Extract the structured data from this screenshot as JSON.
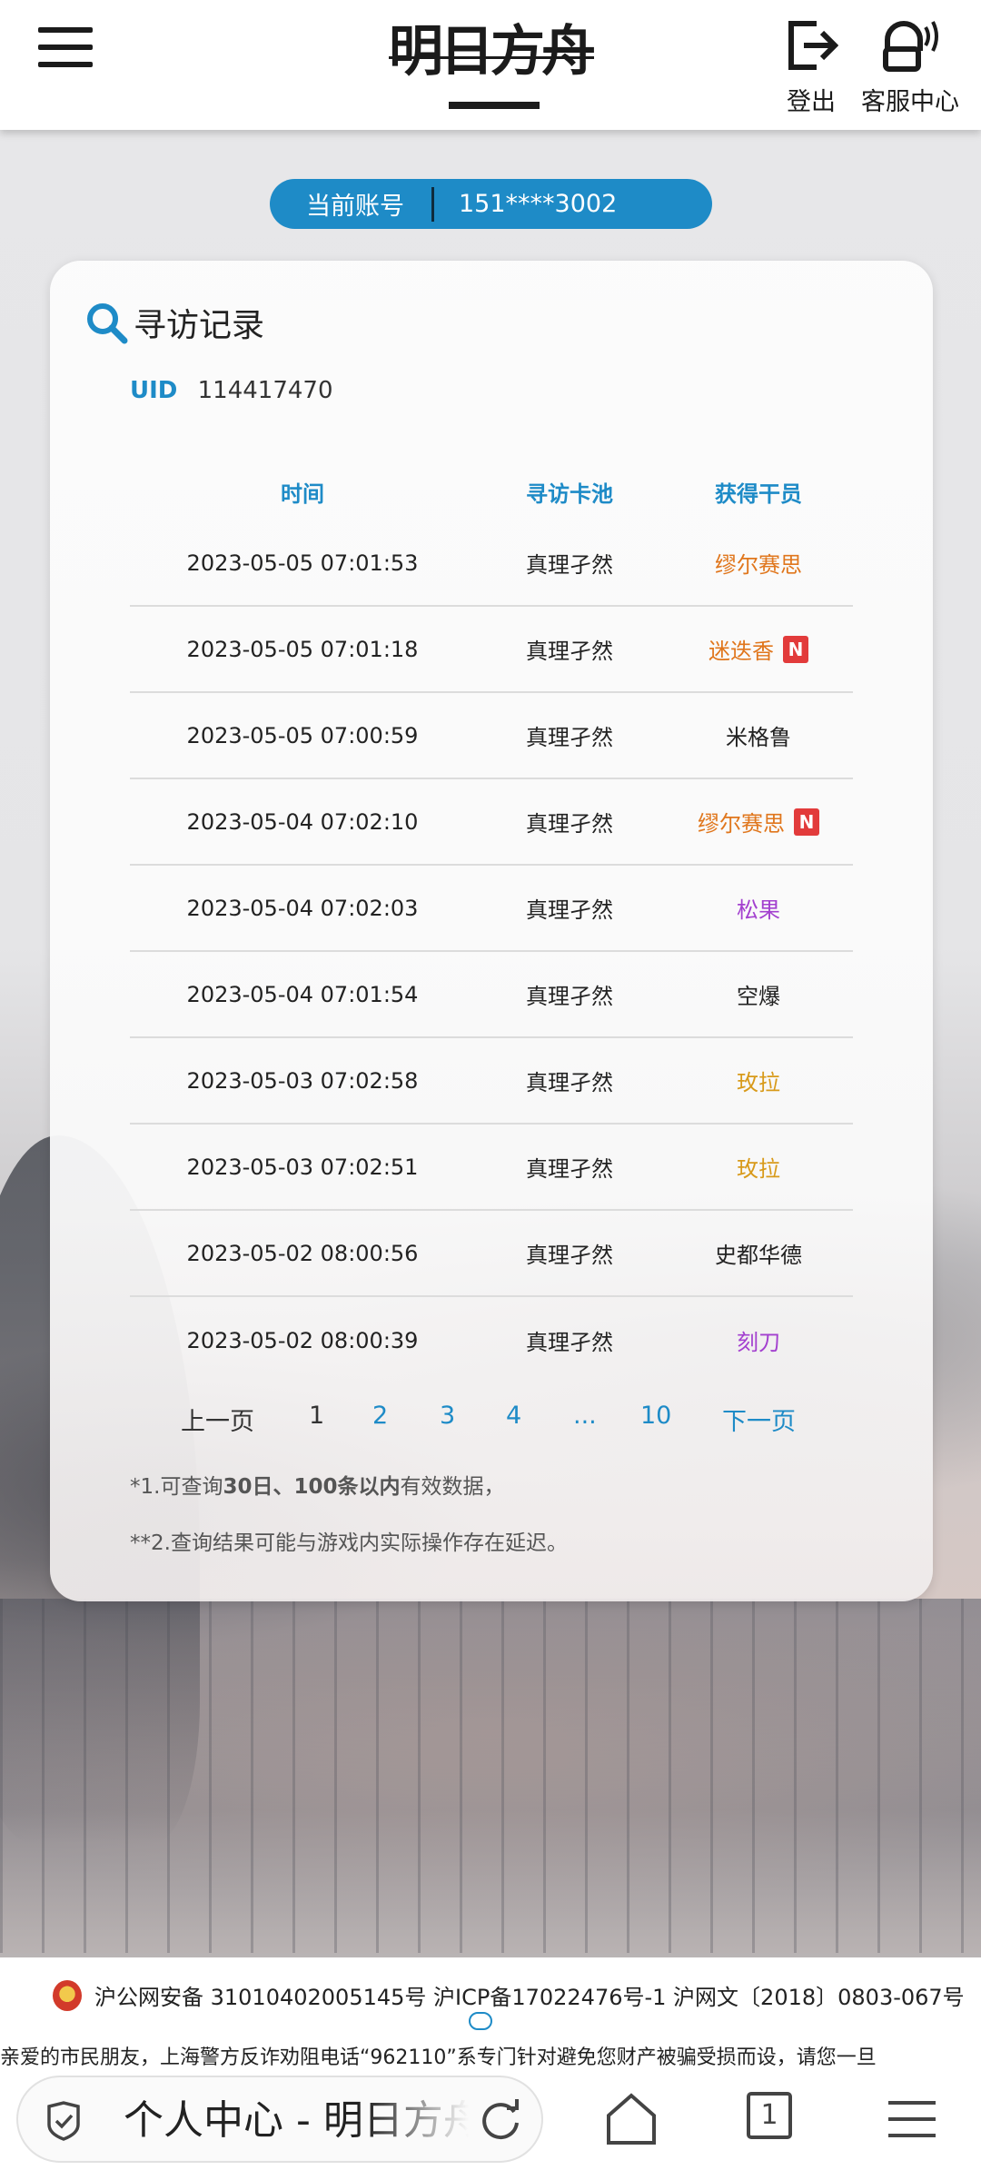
{
  "header": {
    "logo_text": "明日方舟",
    "logout_label": "登出",
    "service_label": "客服中心"
  },
  "account": {
    "label": "当前账号",
    "value": "151****3002"
  },
  "card": {
    "title": "寻访记录",
    "uid_label": "UID",
    "uid_value": "114417470",
    "columns": {
      "time": "时间",
      "pool": "寻访卡池",
      "operator": "获得干员"
    },
    "rows": [
      {
        "time": "2023-05-05 07:01:53",
        "pool": "真理孑然",
        "operator": "缪尔赛思",
        "rarity": "orange",
        "new": ""
      },
      {
        "time": "2023-05-05 07:01:18",
        "pool": "真理孑然",
        "operator": "迷迭香",
        "rarity": "orange",
        "new": "N"
      },
      {
        "time": "2023-05-05 07:00:59",
        "pool": "真理孑然",
        "operator": "米格鲁",
        "rarity": "normal",
        "new": ""
      },
      {
        "time": "2023-05-04 07:02:10",
        "pool": "真理孑然",
        "operator": "缪尔赛思",
        "rarity": "orange",
        "new": "N"
      },
      {
        "time": "2023-05-04 07:02:03",
        "pool": "真理孑然",
        "operator": "松果",
        "rarity": "purple",
        "new": ""
      },
      {
        "time": "2023-05-04 07:01:54",
        "pool": "真理孑然",
        "operator": "空爆",
        "rarity": "normal",
        "new": ""
      },
      {
        "time": "2023-05-03 07:02:58",
        "pool": "真理孑然",
        "operator": "玫拉",
        "rarity": "gold",
        "new": ""
      },
      {
        "time": "2023-05-03 07:02:51",
        "pool": "真理孑然",
        "operator": "玫拉",
        "rarity": "gold",
        "new": ""
      },
      {
        "time": "2023-05-02 08:00:56",
        "pool": "真理孑然",
        "operator": "史都华德",
        "rarity": "normal",
        "new": ""
      },
      {
        "time": "2023-05-02 08:00:39",
        "pool": "真理孑然",
        "operator": "刻刀",
        "rarity": "purple",
        "new": ""
      }
    ],
    "pagination": {
      "prev": "上一页",
      "current": "1",
      "pages": [
        "2",
        "3",
        "4"
      ],
      "ellipsis": "...",
      "last": "10",
      "next": "下一页"
    },
    "notes": {
      "n1_pre": "*1.可查询",
      "n1_bold": "30日、100条以内",
      "n1_post": "有效数据，",
      "n2": "**2.查询结果可能与游戏内实际操作存在延迟。"
    }
  },
  "colors": {
    "accent": "#1e8bc7",
    "orange": "#e0761c",
    "gold": "#d89a1a",
    "purple": "#a340cf",
    "new_badge": "#e23b3b"
  },
  "footer": {
    "icp": "沪公网安备 31010402005145号  沪ICP备17022476号-1  沪网文〔2018〕0803-067号",
    "ticker": "亲爱的市民朋友，上海警方反诈劝阻电话“962110”系专门针对避免您财产被骗受损而设，请您一旦"
  },
  "browser": {
    "page_title": "个人中心 - 明日方舟",
    "tab_count": "1"
  }
}
